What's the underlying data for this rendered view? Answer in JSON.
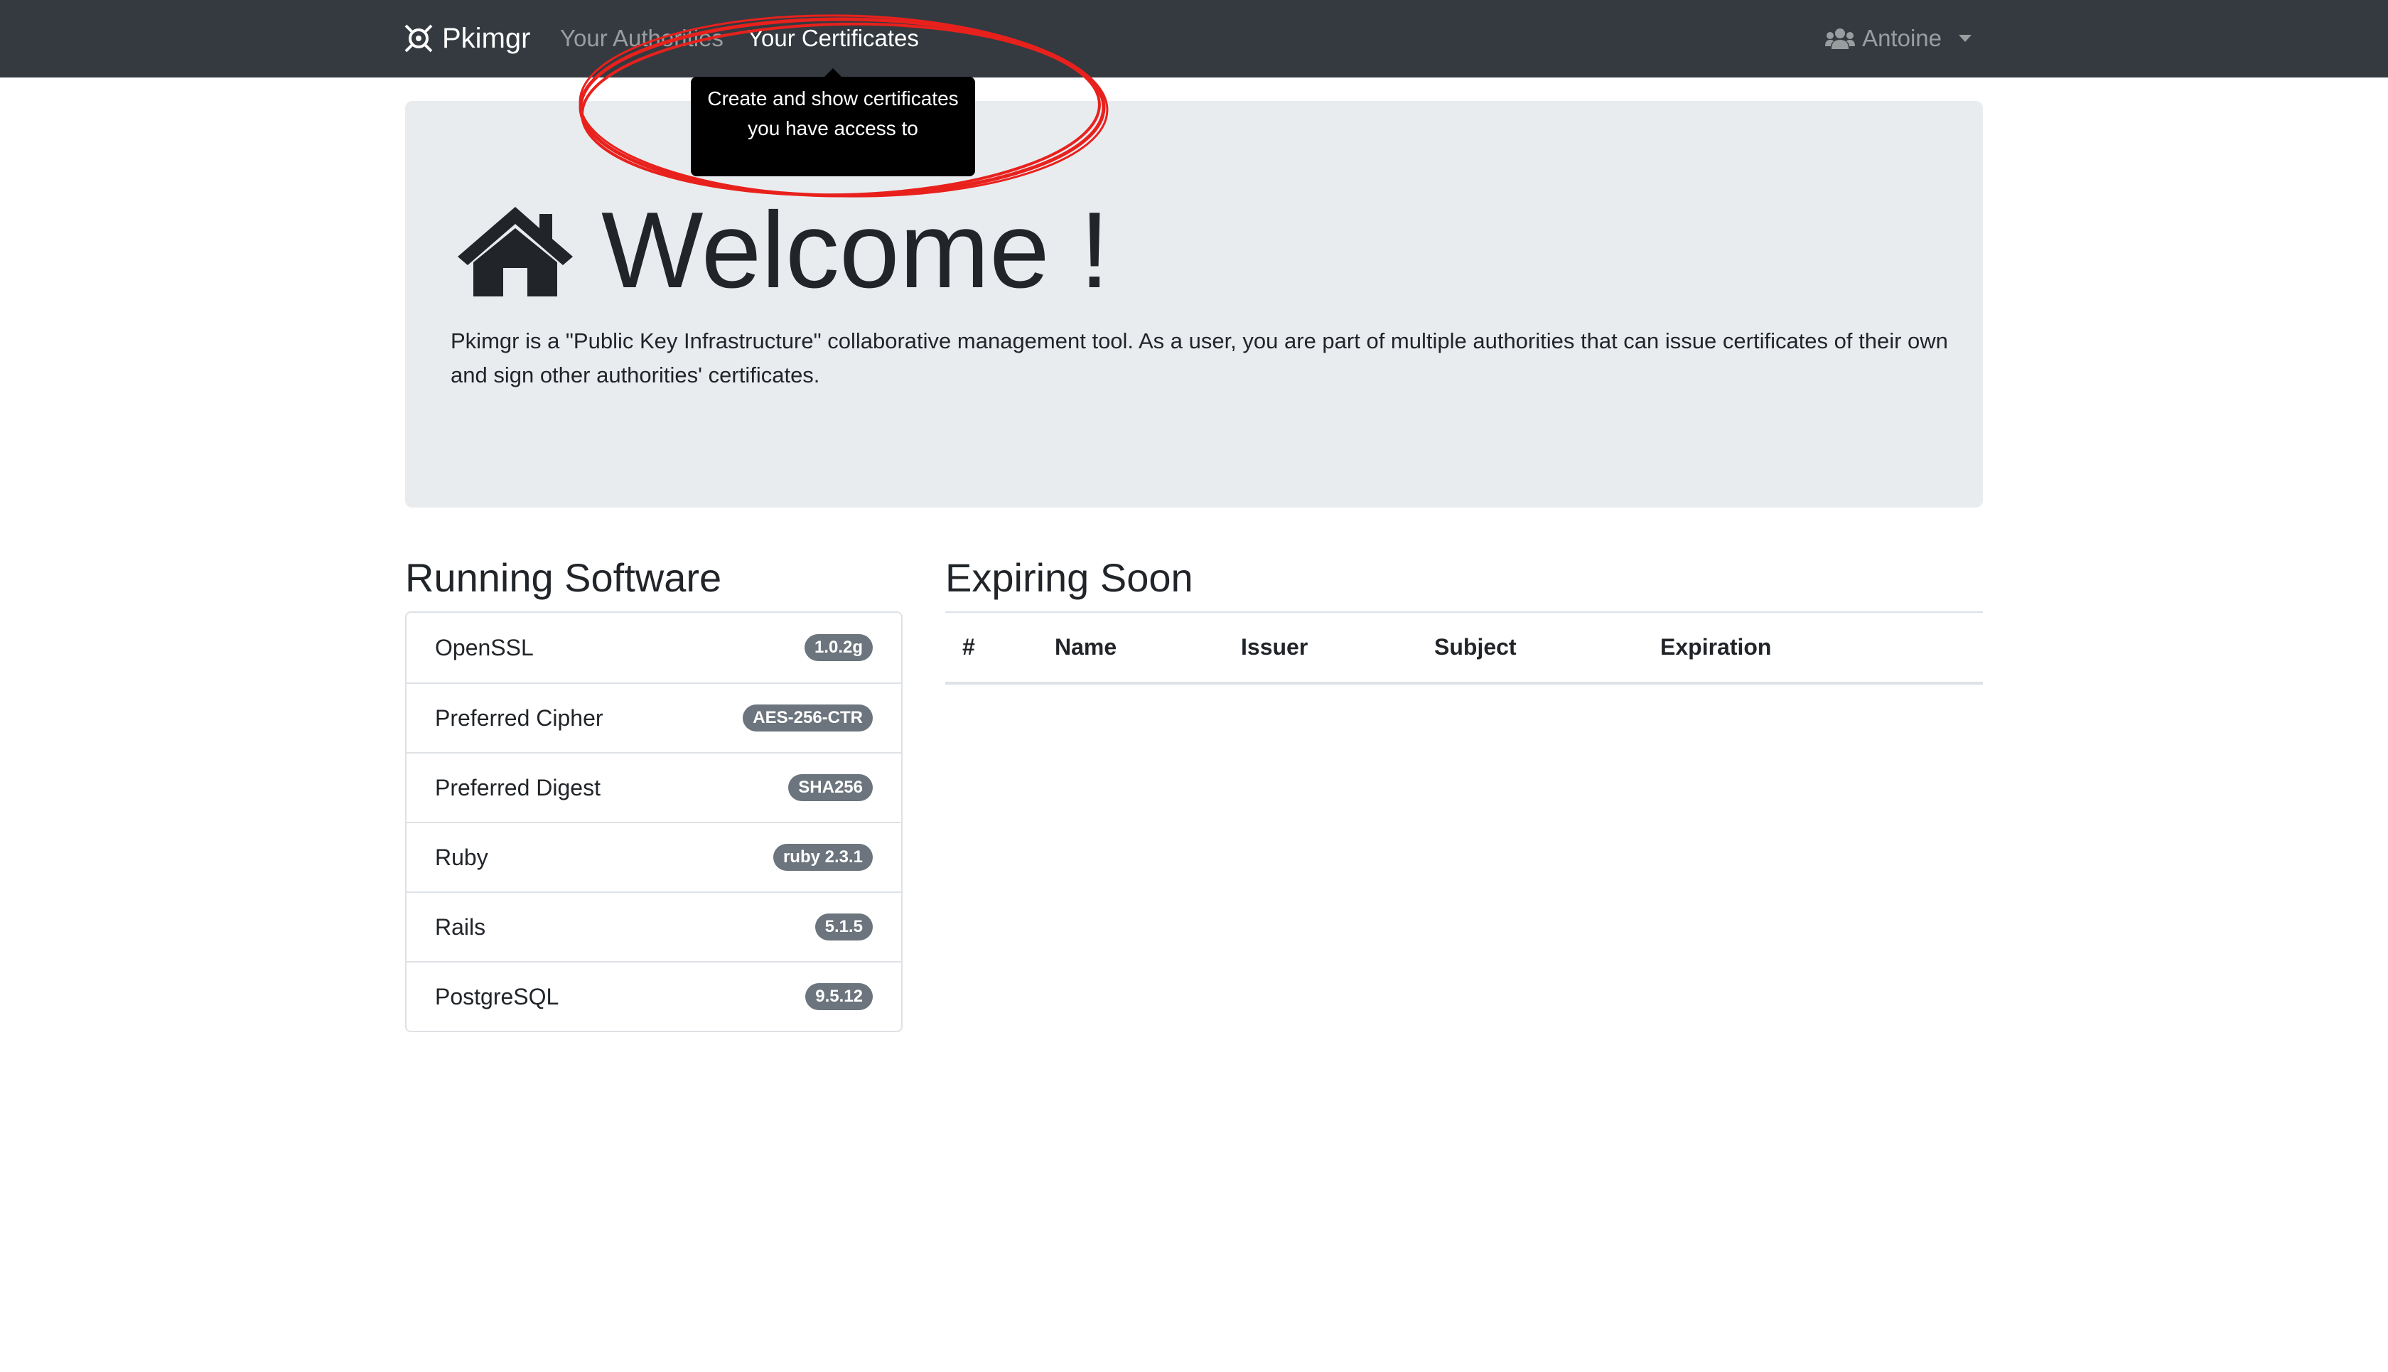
{
  "navbar": {
    "brand": "Pkimgr",
    "links": [
      {
        "label": "Your Authorities",
        "active": false
      },
      {
        "label": "Your Certificates",
        "active": true
      }
    ],
    "user": "Antoine"
  },
  "tooltip": {
    "text": "Create and show certificates you have access to"
  },
  "annotation": {
    "color": "#e8211d",
    "shape": "ellipse"
  },
  "jumbotron": {
    "icon": "home-icon",
    "title": "Welcome !",
    "lead": "Pkimgr is a \"Public Key Infrastructure\" collaborative management tool. As a user, you are part of multiple authorities that can issue certificates of their own and sign other authorities' certificates."
  },
  "running_software": {
    "title": "Running Software",
    "items": [
      {
        "label": "OpenSSL",
        "value": "1.0.2g"
      },
      {
        "label": "Preferred Cipher",
        "value": "AES-256-CTR"
      },
      {
        "label": "Preferred Digest",
        "value": "SHA256"
      },
      {
        "label": "Ruby",
        "value": "ruby 2.3.1"
      },
      {
        "label": "Rails",
        "value": "5.1.5"
      },
      {
        "label": "PostgreSQL",
        "value": "9.5.12"
      }
    ]
  },
  "expiring": {
    "title": "Expiring Soon",
    "columns": [
      "#",
      "Name",
      "Issuer",
      "Subject",
      "Expiration"
    ],
    "rows": []
  },
  "colors": {
    "navbar": "#343a40",
    "jumbotron": "#e9ecef",
    "badge": "#6c757d"
  }
}
